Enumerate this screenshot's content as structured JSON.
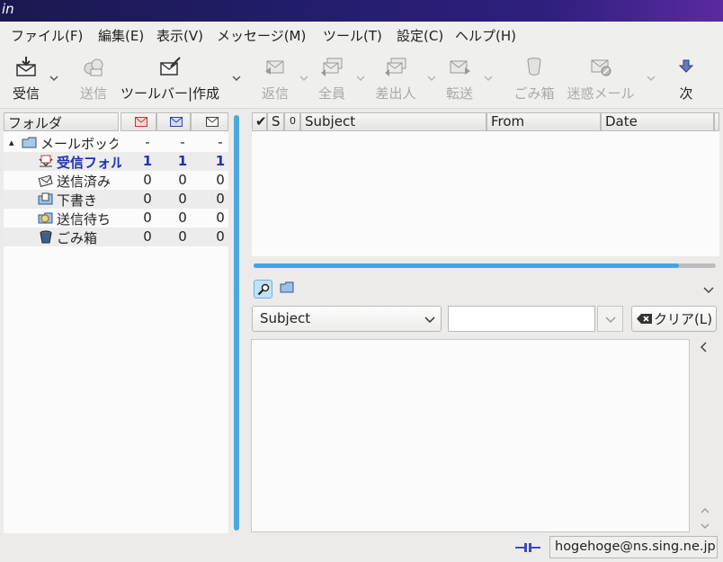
{
  "window": {
    "title": "in"
  },
  "menu": [
    "ファイル(F)",
    "編集(E)",
    "表示(V)",
    "メッセージ(M)",
    "ツール(T)",
    "設定(C)",
    "ヘルプ(H)"
  ],
  "toolbar": {
    "receive": "受信",
    "send": "送信",
    "compose": "ツールバー|作成",
    "reply": "返信",
    "reply_all": "全員",
    "sender": "差出人",
    "forward": "転送",
    "trash": "ごみ箱",
    "spam": "迷惑メール",
    "next": "次"
  },
  "folders": {
    "header": "フォルダ",
    "items": [
      {
        "name": "メールボック",
        "unread": "-",
        "new": "-",
        "total": "-"
      },
      {
        "name": "受信フォル",
        "unread": "1",
        "new": "1",
        "total": "1"
      },
      {
        "name": "送信済み",
        "unread": "0",
        "new": "0",
        "total": "0"
      },
      {
        "name": "下書き",
        "unread": "0",
        "new": "0",
        "total": "0"
      },
      {
        "name": "送信待ち",
        "unread": "0",
        "new": "0",
        "total": "0"
      },
      {
        "name": "ごみ箱",
        "unread": "0",
        "new": "0",
        "total": "0"
      }
    ]
  },
  "message_list": {
    "columns": {
      "check": "✔",
      "status": "S",
      "attach": "0",
      "subject": "Subject",
      "from": "From",
      "date": "Date"
    }
  },
  "search": {
    "field_selected": "Subject",
    "query": "",
    "clear": "クリア(L)"
  },
  "progress": {
    "fraction": 0.92
  },
  "status": {
    "account": "hogehoge@ns.sing.ne.jp"
  },
  "colors": {
    "accent": "#3fa6df",
    "unread_text": "#1d33b5",
    "titlebar": "#221d6a"
  }
}
